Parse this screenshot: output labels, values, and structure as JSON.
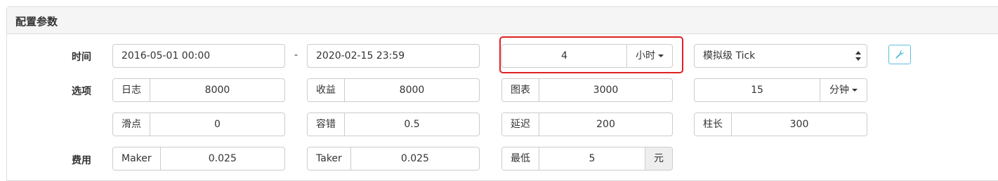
{
  "panel": {
    "title": "配置参数"
  },
  "row_time": {
    "label": "时间",
    "start": "2016-05-01 00:00",
    "separator": "-",
    "end": "2020-02-15 23:59",
    "period_value": "4",
    "period_unit": "小时",
    "mode": "模拟级 Tick"
  },
  "row_options": {
    "label": "选项",
    "log": {
      "label": "日志",
      "value": "8000"
    },
    "profit": {
      "label": "收益",
      "value": "8000"
    },
    "chart": {
      "label": "图表",
      "value": "3000"
    },
    "kline": {
      "value": "15",
      "unit": "分钟"
    }
  },
  "row_options2": {
    "slippage": {
      "label": "滑点",
      "value": "0"
    },
    "tolerance": {
      "label": "容错",
      "value": "0.5"
    },
    "delay": {
      "label": "延迟",
      "value": "200"
    },
    "bar_length": {
      "label": "柱长",
      "value": "300"
    }
  },
  "row_fee": {
    "label": "费用",
    "maker": {
      "label": "Maker",
      "value": "0.025"
    },
    "taker": {
      "label": "Taker",
      "value": "0.025"
    },
    "minimum": {
      "label": "最低",
      "value": "5",
      "unit": "元"
    }
  },
  "colors": {
    "highlight": "#e02020",
    "info": "#5bc0de",
    "border": "#cccccc"
  },
  "icons": {
    "tool_button": "wrench-icon"
  }
}
